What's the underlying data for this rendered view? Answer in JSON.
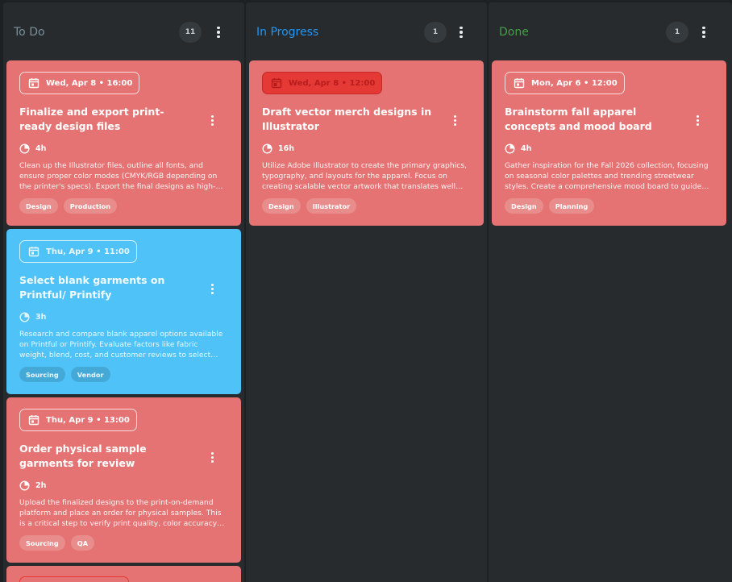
{
  "columns": [
    {
      "title": "To Do",
      "title_color": "#7a8f9a",
      "count": "11",
      "cards": [
        {
          "color": "red",
          "date": "Wed, Apr 8 • 16:00",
          "date_overdue": false,
          "title": "Finalize and export print-ready design files",
          "estimate": "4h",
          "description": "Clean up the Illustrator files, outline all fonts, and ensure proper color modes (CMYK/RGB depending on the printer's specs). Export the final designs as high-r…",
          "tags": [
            "Design",
            "Production"
          ]
        },
        {
          "color": "blue",
          "date": "Thu, Apr 9 • 11:00",
          "date_overdue": false,
          "title": "Select blank garments on Printful/ Printify",
          "estimate": "3h",
          "description": "Research and compare blank apparel options available on Printful or Printify. Evaluate factors like fabric weight, blend, cost, and customer reviews to select th…",
          "tags": [
            "Sourcing",
            "Vendor"
          ]
        },
        {
          "color": "red",
          "date": "Thu, Apr 9 • 13:00",
          "date_overdue": false,
          "title": "Order physical sample garments for review",
          "estimate": "2h",
          "description": "Upload the finalized designs to the print-on-demand platform and place an order for physical samples. This is a critical step to verify print quality, color accuracy, …",
          "tags": [
            "Sourcing",
            "QA"
          ]
        }
      ]
    },
    {
      "title": "In Progress",
      "title_color": "#2196f3",
      "count": "1",
      "cards": [
        {
          "color": "red",
          "date": "Wed, Apr 8 • 12:00",
          "date_overdue": true,
          "title": "Draft vector merch designs in Illustrator",
          "estimate": "16h",
          "description": "Utilize Adobe Illustrator to create the primary graphics, typography, and layouts for the apparel. Focus on creating scalable vector artwork that translates well to…",
          "tags": [
            "Design",
            "Illustrator"
          ]
        }
      ]
    },
    {
      "title": "Done",
      "title_color": "#43a047",
      "count": "1",
      "cards": [
        {
          "color": "red",
          "date": "Mon, Apr 6 • 12:00",
          "date_overdue": false,
          "title": "Brainstorm fall apparel concepts and mood board",
          "estimate": "4h",
          "description": "Gather inspiration for the Fall 2026 collection, focusing on seasonal color palettes and trending streetwear styles. Create a comprehensive mood board to guide t…",
          "tags": [
            "Design",
            "Planning"
          ]
        }
      ]
    }
  ],
  "icons": {
    "date": "calendar-icon",
    "estimate": "timer-icon",
    "menu": "more-vertical-icon"
  },
  "colors": {
    "card_red": "#e57373",
    "card_blue": "#4fc3f7",
    "overdue": "#e53935",
    "column_bg": "#272b2e",
    "background": "#1e2124"
  }
}
